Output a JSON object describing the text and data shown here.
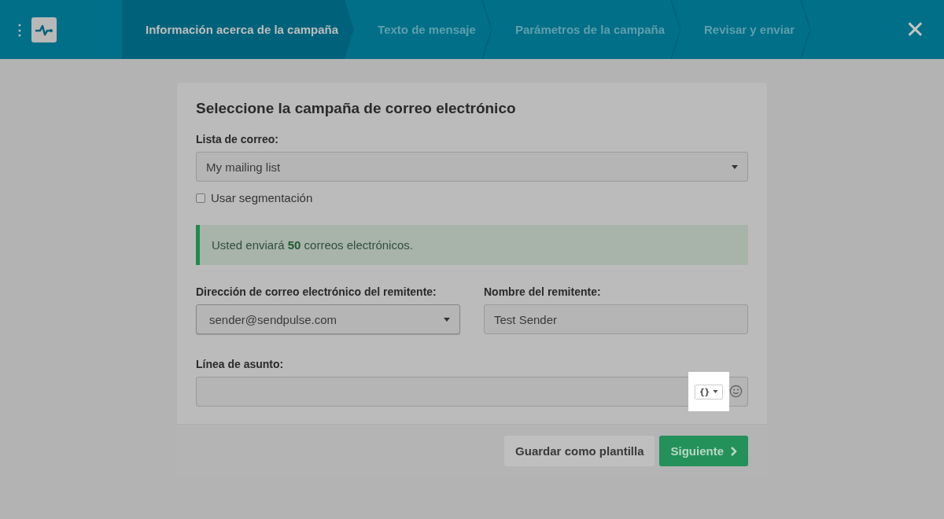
{
  "header": {
    "menu_glyph": "⋮",
    "steps": [
      {
        "label": "Información acerca de la campaña",
        "selected": true
      },
      {
        "label": "Texto de mensaje",
        "selected": false
      },
      {
        "label": "Parámetros de la campaña",
        "selected": false
      },
      {
        "label": "Revisar y enviar",
        "selected": false
      }
    ],
    "close_glyph": "✕"
  },
  "card": {
    "title": "Seleccione la campaña de correo electrónico",
    "mailing_list": {
      "label": "Lista de correo:",
      "value": "My mailing list"
    },
    "segmentation": {
      "label": "Usar segmentación",
      "checked": false
    },
    "notice": "Usted enviará **50** correos electrónicos.",
    "sender_email": {
      "label": "Dirección de correo electrónico del remitente:",
      "value": "sender@sendpulse.com"
    },
    "sender_name": {
      "label": "Nombre del remitente:",
      "value": "Test Sender"
    },
    "subject": {
      "label": "Línea de asunto:",
      "variables_glyph": "{}"
    },
    "buttons": [
      {
        "label": "Guardar como plantilla",
        "kind": "secondary"
      },
      {
        "label": "Siguiente",
        "kind": "primary"
      }
    ]
  }
}
